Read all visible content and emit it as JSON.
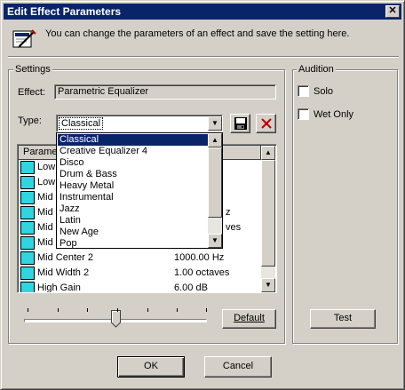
{
  "window": {
    "title": "Edit Effect Parameters",
    "close_glyph": "✕"
  },
  "info": {
    "text": "You can change the parameters of an effect and save the setting here.",
    "icon": "edit-dialog-icon"
  },
  "settings": {
    "group_label": "Settings",
    "effect_label": "Effect:",
    "effect_value": "Parametric Equalizer",
    "type_label": "Type:",
    "type_value": "Classical",
    "save_icon": "save-icon",
    "delete_icon": "delete-icon",
    "list_header": "Parame",
    "rows": [
      {
        "name": "Low",
        "value": ""
      },
      {
        "name": "Low",
        "value": ""
      },
      {
        "name": "Mid",
        "value": ""
      },
      {
        "name": "Mid",
        "value": "z"
      },
      {
        "name": "Mid",
        "value": "ves"
      },
      {
        "name": "Mid",
        "value": ""
      },
      {
        "name": "Mid Center 2",
        "value": "1000.00 Hz"
      },
      {
        "name": "Mid Width 2",
        "value": "1.00 octaves"
      },
      {
        "name": "High Gain",
        "value": "6.00 dB"
      }
    ],
    "default_button": "Default",
    "slider_level": 0.5
  },
  "dropdown": {
    "options": [
      "Classical",
      "Creative Equalizer 4",
      "Disco",
      "Drum & Bass",
      "Heavy Metal",
      "Instrumental",
      "Jazz",
      "Latin",
      "New Age",
      "Pop"
    ],
    "selected_index": 0
  },
  "audition": {
    "group_label": "Audition",
    "solo_label": "Solo",
    "wet_only_label": "Wet Only",
    "test_button": "Test"
  },
  "footer": {
    "ok": "OK",
    "cancel": "Cancel"
  },
  "colors": {
    "titlebar": "#0a246a",
    "face": "#d4d0c8",
    "selection": "#0a246a",
    "param_icon": "#2fd6e0",
    "delete_red": "#c00000"
  }
}
